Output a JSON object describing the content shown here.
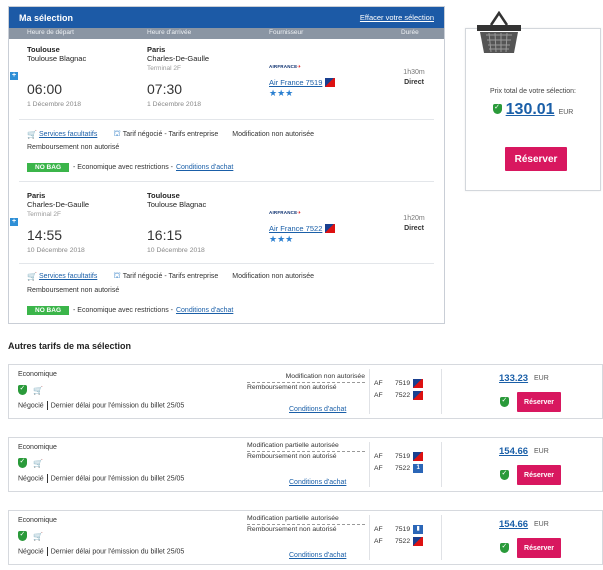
{
  "selection": {
    "title": "Ma sélection",
    "clear_link": "Effacer votre sélection",
    "columns": {
      "departure": "Heure de départ",
      "arrival": "Heure d'arrivée",
      "supplier": "Fournisseur",
      "duration": "Durée"
    },
    "outbound": {
      "dep_city": "Toulouse",
      "dep_airport": "Toulouse Blagnac",
      "dep_terminal": "",
      "dep_time": "06:00",
      "dep_date": "1 Décembre 2018",
      "arr_city": "Paris",
      "arr_airport": "Charles-De-Gaulle",
      "arr_terminal": "Terminal 2F",
      "arr_time": "07:30",
      "arr_date": "1 Décembre 2018",
      "airline_logo": "AIRFRANCE",
      "flight": "Air France 7519",
      "duration": "1h30m",
      "stops": "Direct",
      "services_link": "Services facultatifs",
      "tariff": "Tarif négocié - Tarifs entreprise",
      "modification": "Modification non autorisée",
      "refund": "Remboursement non autorisé",
      "nobag": "NO BAG",
      "fare_class": "- Economique avec restrictions -",
      "conditions_link": "Conditions d'achat"
    },
    "inbound": {
      "dep_city": "Paris",
      "dep_airport": "Charles-De-Gaulle",
      "dep_terminal": "Terminal 2F",
      "dep_time": "14:55",
      "dep_date": "10 Décembre 2018",
      "arr_city": "Toulouse",
      "arr_airport": "Toulouse Blagnac",
      "arr_time": "16:15",
      "arr_date": "10 Décembre 2018",
      "airline_logo": "AIRFRANCE",
      "flight": "Air France 7522",
      "duration": "1h20m",
      "stops": "Direct",
      "services_link": "Services facultatifs",
      "tariff": "Tarif négocié - Tarifs entreprise",
      "modification": "Modification non autorisée",
      "refund": "Remboursement non autorisé",
      "nobag": "NO BAG",
      "fare_class": "- Economique avec restrictions -",
      "conditions_link": "Conditions d'achat"
    }
  },
  "total": {
    "label": "Prix total de votre sélection:",
    "price": "130.01",
    "currency": "EUR",
    "reserve": "Réserver"
  },
  "other": {
    "title": "Autres tarifs de ma sélection",
    "fares": [
      {
        "type": "Economique",
        "note_a": "Négocié",
        "note_b": "Dernier délai pour l'émission du billet 25/05",
        "mod": "Modification non autorisée",
        "refund": "Remboursement non autorisé",
        "conditions": "Conditions d'achat",
        "air1": "AF",
        "fl1": "7519",
        "air2": "AF",
        "fl2": "7522",
        "price": "133.23",
        "currency": "EUR",
        "reserve": "Réserver"
      },
      {
        "type": "Economique",
        "note_a": "Négocié",
        "note_b": "Dernier délai pour l'émission du billet 25/05",
        "mod": "Modification partielle autorisée",
        "refund": "Remboursement non autorisé",
        "conditions": "Conditions d'achat",
        "air1": "AF",
        "fl1": "7519",
        "air2": "AF",
        "fl2": "7522",
        "price": "154.66",
        "currency": "EUR",
        "reserve": "Réserver"
      },
      {
        "type": "Economique",
        "note_a": "Négocié",
        "note_b": "Dernier délai pour l'émission du billet 25/05",
        "mod": "Modification partielle autorisée",
        "refund": "Remboursement non autorisé",
        "conditions": "Conditions d'achat",
        "air1": "AF",
        "fl1": "7519",
        "air2": "AF",
        "fl2": "7522",
        "price": "154.66",
        "currency": "EUR",
        "reserve": "Réserver"
      }
    ]
  }
}
